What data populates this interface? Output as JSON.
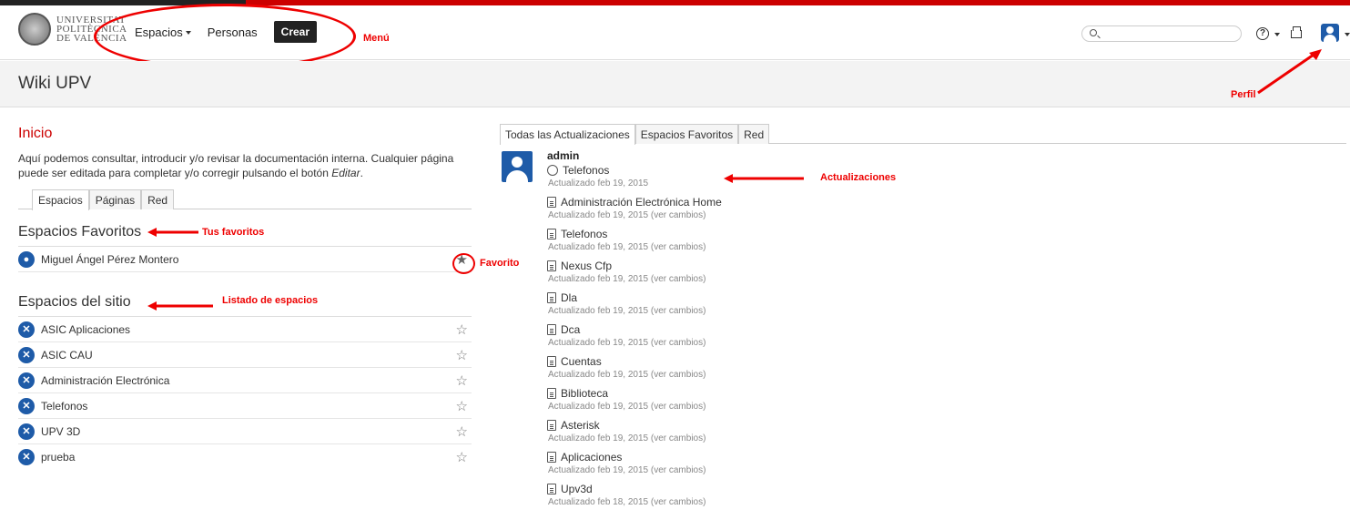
{
  "header": {
    "logo_lines": [
      "UNIVERSITAT",
      "POLITÈCNICA",
      "DE VALÈNCIA"
    ],
    "nav": [
      {
        "label": "Espacios",
        "dropdown": true
      },
      {
        "label": "Personas",
        "dropdown": false
      }
    ],
    "create_label": "Crear",
    "search_placeholder": "",
    "help_icon": "?"
  },
  "annotations": {
    "menu": "Menú",
    "perfil": "Perfil",
    "tus_favoritos": "Tus favoritos",
    "favorito": "Favorito",
    "listado": "Listado de espacios",
    "actualizaciones": "Actualizaciones"
  },
  "page": {
    "title": "Wiki UPV"
  },
  "home": {
    "title": "Inicio",
    "intro_part1": "Aquí podemos consultar, introducir y/o revisar la documentación interna. Cualquier página puede ser editada para completar y/o corregir pulsando el botón ",
    "intro_em": "Editar",
    "intro_part2": ".",
    "tabs": [
      "Espacios",
      "Páginas",
      "Red"
    ],
    "favorites_title": "Espacios Favoritos",
    "favorites": [
      "Miguel Ángel Pérez Montero"
    ],
    "sites_title": "Espacios del sitio",
    "sites": [
      "ASIC Aplicaciones",
      "ASIC CAU",
      "Administración Electrónica",
      "Telefonos",
      "UPV 3D",
      "prueba"
    ]
  },
  "activity": {
    "tabs": [
      "Todas las Actualizaciones",
      "Espacios Favoritos",
      "Red"
    ],
    "user": "admin",
    "entries": [
      {
        "title": "Telefonos",
        "sub": "Actualizado feb 19, 2015",
        "icon": "globe-icon"
      },
      {
        "title": "Administración Electrónica Home",
        "sub": "Actualizado feb 19, 2015 (ver cambios)",
        "icon": "home-doc-icon"
      },
      {
        "title": "Telefonos",
        "sub": "Actualizado feb 19, 2015 (ver cambios)",
        "icon": "document-icon"
      },
      {
        "title": "Nexus Cfp",
        "sub": "Actualizado feb 19, 2015 (ver cambios)",
        "icon": "document-icon"
      },
      {
        "title": "Dla",
        "sub": "Actualizado feb 19, 2015 (ver cambios)",
        "icon": "document-icon"
      },
      {
        "title": "Dca",
        "sub": "Actualizado feb 19, 2015 (ver cambios)",
        "icon": "document-icon"
      },
      {
        "title": "Cuentas",
        "sub": "Actualizado feb 19, 2015 (ver cambios)",
        "icon": "document-icon"
      },
      {
        "title": "Biblioteca",
        "sub": "Actualizado feb 19, 2015 (ver cambios)",
        "icon": "document-icon"
      },
      {
        "title": "Asterisk",
        "sub": "Actualizado feb 19, 2015 (ver cambios)",
        "icon": "document-icon"
      },
      {
        "title": "Aplicaciones",
        "sub": "Actualizado feb 19, 2015 (ver cambios)",
        "icon": "document-icon"
      },
      {
        "title": "Upv3d",
        "sub": "Actualizado feb 18, 2015 (ver cambios)",
        "icon": "document-icon"
      }
    ]
  },
  "colors": {
    "accent_red": "#cc0000",
    "brand_blue": "#1e5ba8",
    "annotation_red": "#ee0000"
  }
}
